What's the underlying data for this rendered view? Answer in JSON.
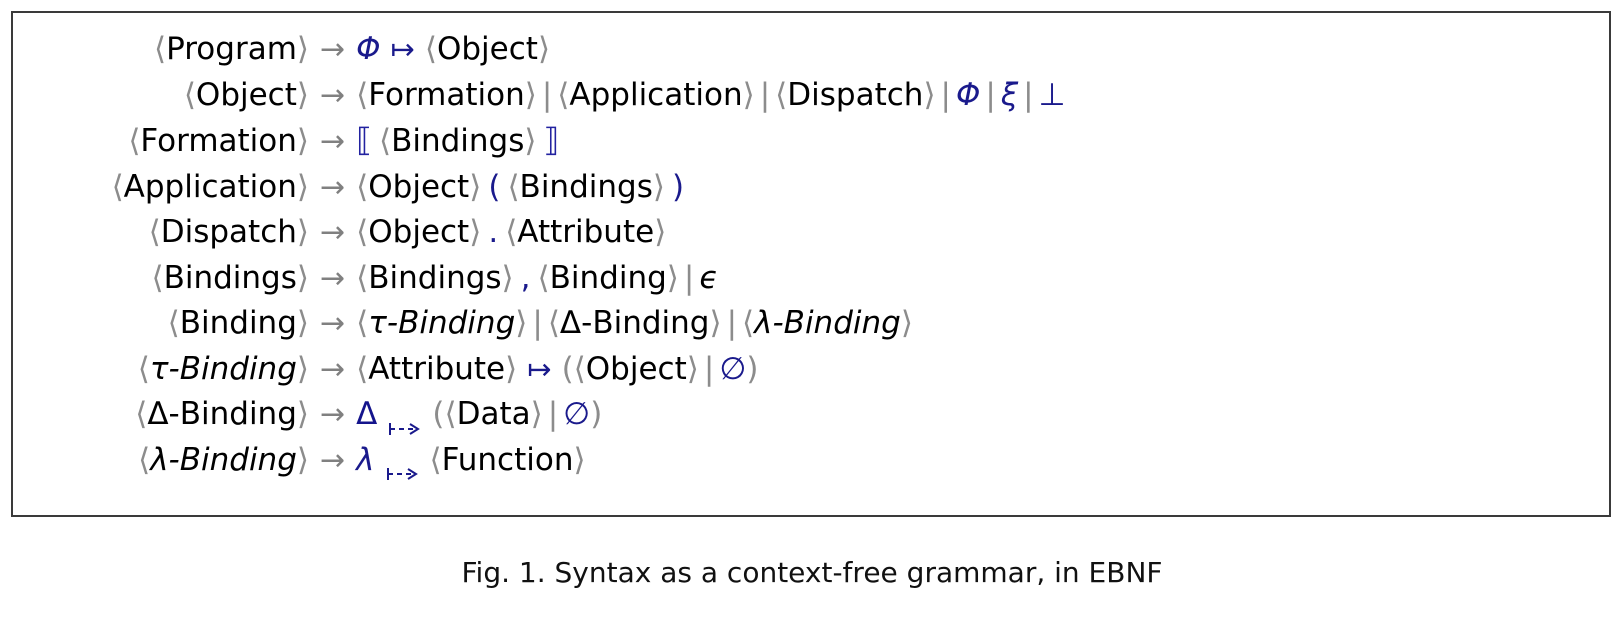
{
  "figure": {
    "caption": "Fig. 1.  Syntax as a context-free grammar, in EBNF",
    "colors": {
      "terminal_blue": "#1a1a8c",
      "bracket_gray": "#8c8c8c",
      "arrow_gray": "#808080",
      "text_black": "#000000",
      "frame": "#3a3a3a"
    }
  },
  "grammar": {
    "arrow": "→",
    "bar": "|",
    "rules": [
      {
        "lhs": "⟨Program⟩",
        "lhs_name": "Program",
        "rhs_text": "Φ ↦ ⟨Object⟩"
      },
      {
        "lhs": "⟨Object⟩",
        "lhs_name": "Object",
        "rhs_text": "⟨Formation⟩ | ⟨Application⟩ | ⟨Dispatch⟩ | Φ | ξ | ⊥"
      },
      {
        "lhs": "⟨Formation⟩",
        "lhs_name": "Formation",
        "rhs_text": "⟦ ⟨Bindings⟩ ⟧"
      },
      {
        "lhs": "⟨Application⟩",
        "lhs_name": "Application",
        "rhs_text": "⟨Object⟩ ( ⟨Bindings⟩ )"
      },
      {
        "lhs": "⟨Dispatch⟩",
        "lhs_name": "Dispatch",
        "rhs_text": "⟨Object⟩ . ⟨Attribute⟩"
      },
      {
        "lhs": "⟨Bindings⟩",
        "lhs_name": "Bindings",
        "rhs_text": "⟨Bindings⟩ , ⟨Binding⟩ | ϵ"
      },
      {
        "lhs": "⟨Binding⟩",
        "lhs_name": "Binding",
        "rhs_text": "⟨τ-Binding⟩ | ⟨Δ-Binding⟩ | ⟨λ-Binding⟩"
      },
      {
        "lhs": "⟨τ-Binding⟩",
        "lhs_name": "tau-Binding",
        "rhs_text": "⟨Attribute⟩ ↦ (⟨Object⟩ | ∅)"
      },
      {
        "lhs": "⟨Δ-Binding⟩",
        "lhs_name": "Delta-Binding",
        "rhs_text": "Δ ⇢ (⟨Data⟩ | ∅)"
      },
      {
        "lhs": "⟨λ-Binding⟩",
        "lhs_name": "lambda-Binding",
        "rhs_text": "λ ⇢ ⟨Function⟩"
      }
    ],
    "tokens": {
      "angle_open": "⟨",
      "angle_close": "⟩",
      "dbl_open": "⟦",
      "dbl_close": "⟧",
      "paren_open": "(",
      "paren_close": ")",
      "mapsto": "↦",
      "dot": ".",
      "comma": ",",
      "epsilon": "ϵ",
      "empty_set": "∅",
      "phi": "Φ",
      "xi": "ξ",
      "bottom": "⊥",
      "tau": "τ",
      "delta": "Δ",
      "lambda": "λ",
      "program": "Program",
      "object": "Object",
      "formation": "Formation",
      "application": "Application",
      "dispatch": "Dispatch",
      "bindings": "Bindings",
      "binding": "Binding",
      "attribute": "Attribute",
      "data": "Data",
      "function": "Function",
      "tau_binding": "τ-Binding",
      "delta_binding": "Δ-Binding",
      "lambda_binding": "λ-Binding"
    }
  }
}
